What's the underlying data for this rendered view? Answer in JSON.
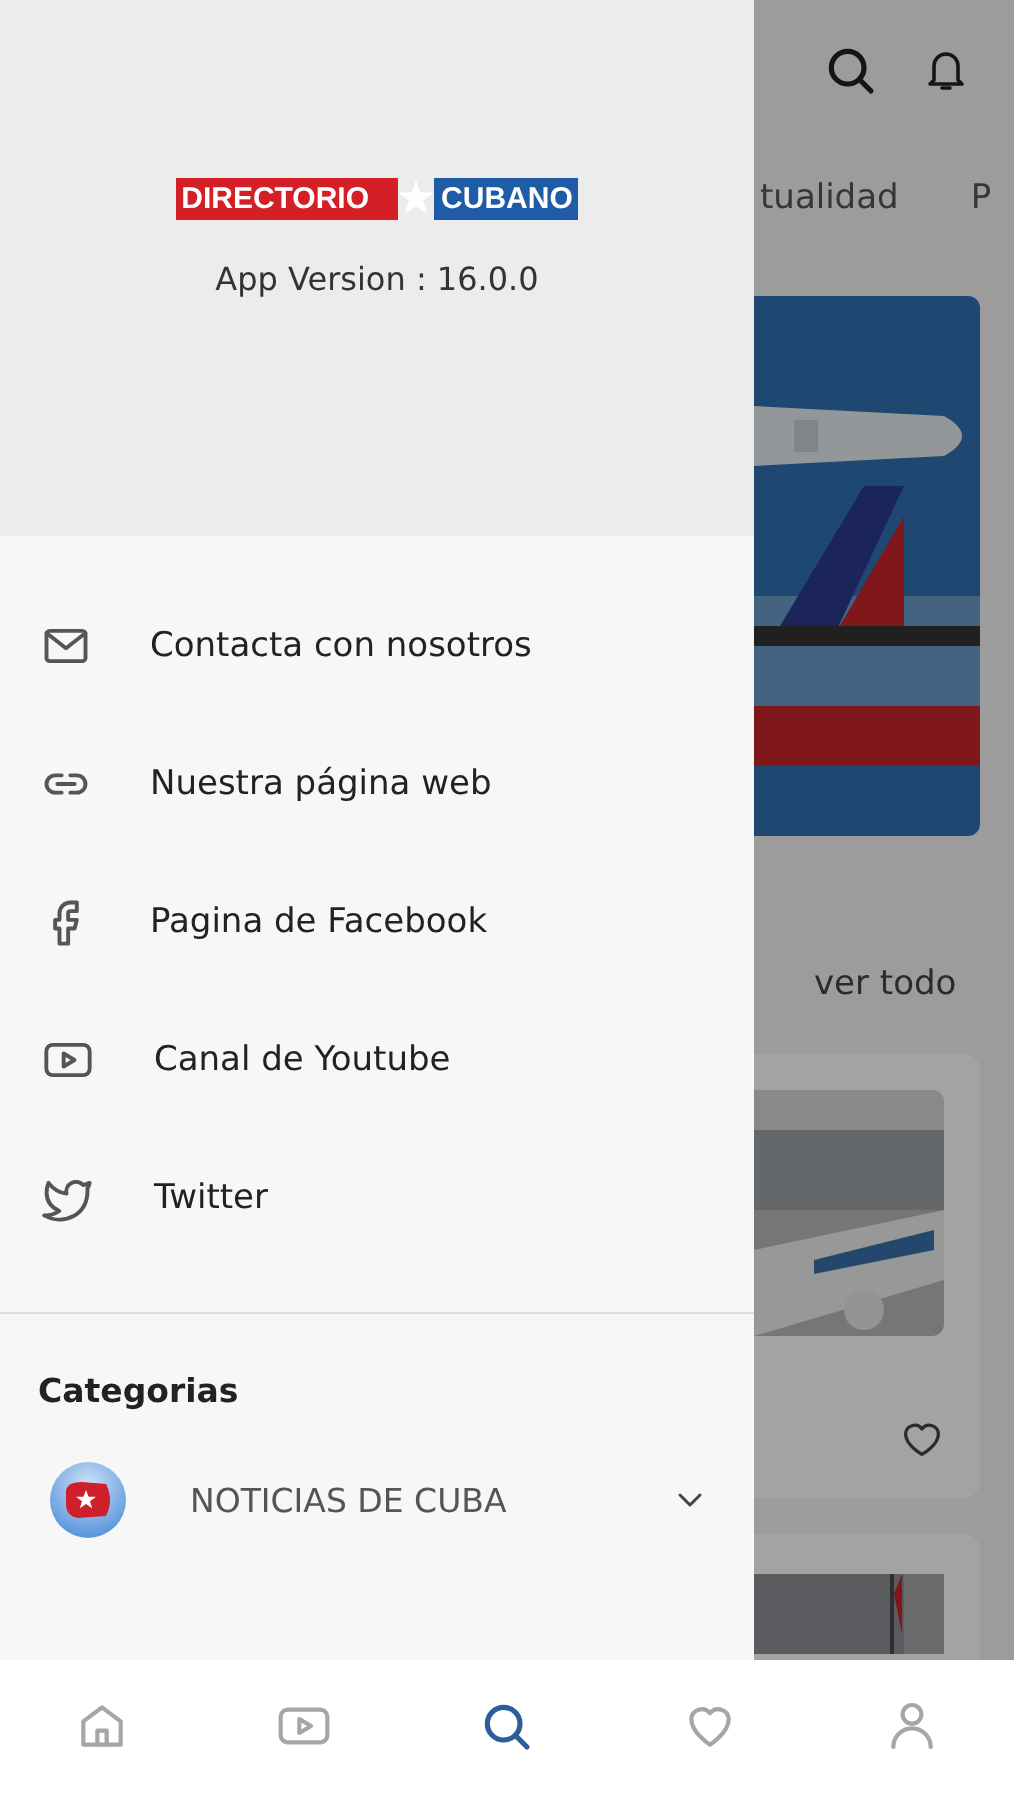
{
  "logo": {
    "left": "DIRECTORIO",
    "right": "CUBANO"
  },
  "app_version": "App Version : 16.0.0",
  "menu": [
    {
      "kind": "mail",
      "label": "Contacta con nosotros"
    },
    {
      "kind": "link",
      "label": "Nuestra página web"
    },
    {
      "kind": "facebook",
      "label": "Pagina de Facebook"
    },
    {
      "kind": "youtube",
      "label": "Canal de Youtube"
    },
    {
      "kind": "twitter",
      "label": "Twitter"
    }
  ],
  "categories_title": "Categorias",
  "categories": [
    {
      "label": "NOTICIAS DE CUBA",
      "expanded": false
    }
  ],
  "background": {
    "tabs": [
      "tualidad",
      "P"
    ],
    "see_all": "ver todo"
  },
  "bottom_nav": [
    {
      "kind": "home",
      "selected": false
    },
    {
      "kind": "video",
      "selected": false
    },
    {
      "kind": "search",
      "selected": true
    },
    {
      "kind": "heart",
      "selected": false
    },
    {
      "kind": "profile",
      "selected": false
    }
  ]
}
